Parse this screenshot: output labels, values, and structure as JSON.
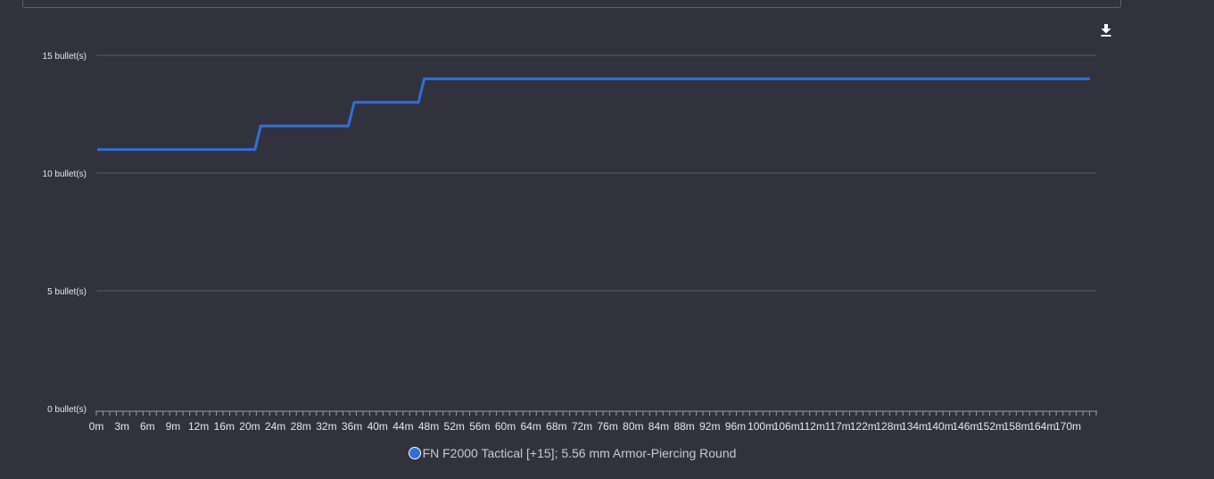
{
  "chart_data": {
    "type": "line",
    "title": "",
    "xlabel": "",
    "ylabel": "",
    "y_unit": "bullet(s)",
    "ylim": [
      0,
      15
    ],
    "yticks": [
      0,
      5,
      10,
      15
    ],
    "ytick_labels": [
      "0 bullet(s)",
      "5 bullet(s)",
      "10 bullet(s)",
      "15 bullet(s)"
    ],
    "x_unit": "m",
    "xlim": [
      0,
      170
    ],
    "xtick_labels": [
      "0m",
      "3m",
      "6m",
      "9m",
      "12m",
      "16m",
      "20m",
      "24m",
      "28m",
      "32m",
      "36m",
      "40m",
      "44m",
      "48m",
      "52m",
      "56m",
      "60m",
      "64m",
      "68m",
      "72m",
      "76m",
      "80m",
      "84m",
      "88m",
      "92m",
      "96m",
      "100m",
      "106m",
      "112m",
      "117m",
      "122m",
      "128m",
      "134m",
      "140m",
      "146m",
      "152m",
      "158m",
      "164m",
      "170m"
    ],
    "grid": true,
    "legend_position": "bottom",
    "series": [
      {
        "name": "FN F2000 Tactical [+15]; 5.56 mm Armor-Piercing Round",
        "color": "#2f6fd8",
        "x": [
          0,
          27,
          28,
          43,
          44,
          55,
          56,
          170
        ],
        "y": [
          11,
          11,
          12,
          12,
          13,
          13,
          14,
          14
        ]
      }
    ]
  },
  "colors": {
    "background": "#32323e",
    "grid": "#5c5c68",
    "text": "#e6e6e6"
  },
  "toolbar": {
    "download_icon": "download-icon"
  }
}
